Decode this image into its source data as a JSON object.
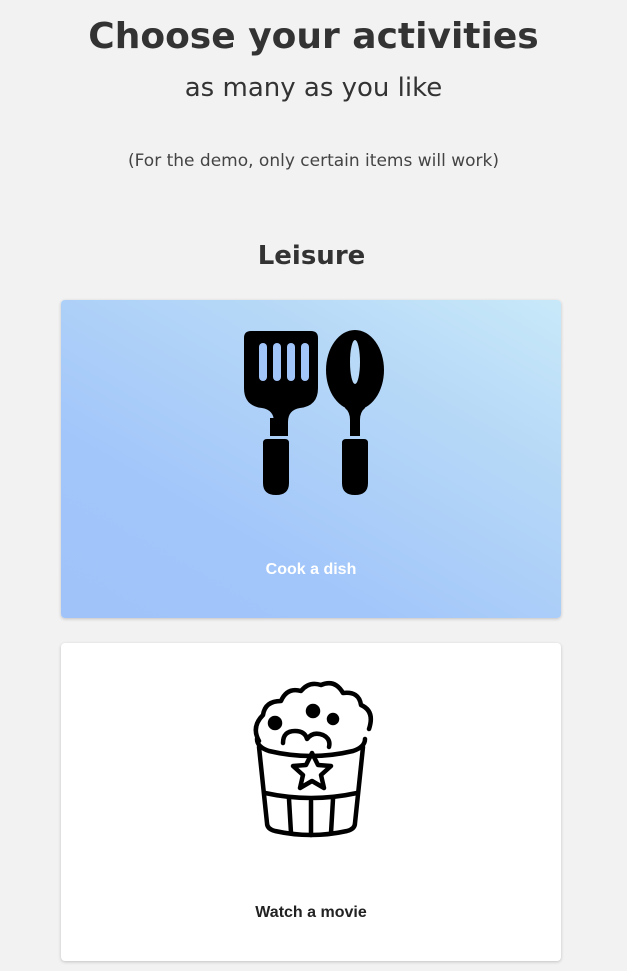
{
  "header": {
    "title": "Choose your activities",
    "subtitle": "as many as you like",
    "note": "(For the demo, only certain items will work)"
  },
  "section": {
    "heading": "Leisure"
  },
  "activities": [
    {
      "label": "Cook a dish",
      "icon": "kitchen-utensils-icon",
      "selected": true
    },
    {
      "label": "Watch a movie",
      "icon": "popcorn-icon",
      "selected": false
    }
  ],
  "colors": {
    "background": "#f2f2f2",
    "selected_gradient_start": "#a0c3f9",
    "selected_gradient_end": "#c8e9f9",
    "card_default": "#ffffff",
    "text": "#333333"
  }
}
